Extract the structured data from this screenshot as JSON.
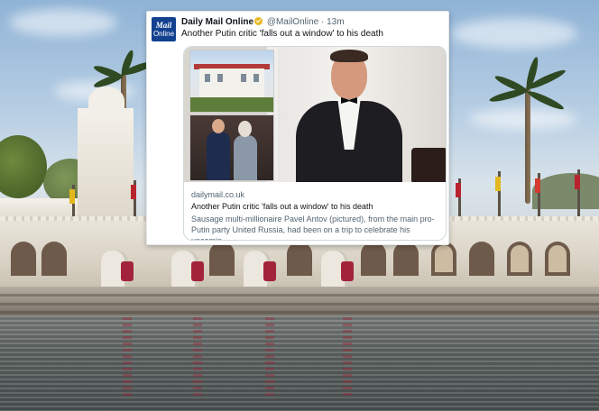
{
  "tweet": {
    "avatar": {
      "line1": "Mail",
      "line2": "Online"
    },
    "author_name": "Daily Mail Online",
    "handle": "@MailOnline",
    "separator": " · ",
    "time": "13m",
    "text": "Another Putin critic 'falls out a window' to his death",
    "link_card": {
      "domain": "dailymail.co.uk",
      "title": "Another Putin critic 'falls out a window' to his death",
      "description": "Sausage multi-millionaire Pavel Antov (pictured), from the main pro-Putin party United Russia, had been on a trip to celebrate his upcomin..."
    }
  },
  "colors": {
    "brand": "#12418f",
    "verified": "#e8b923"
  },
  "icons": {
    "verified": "verified-badge-icon"
  }
}
